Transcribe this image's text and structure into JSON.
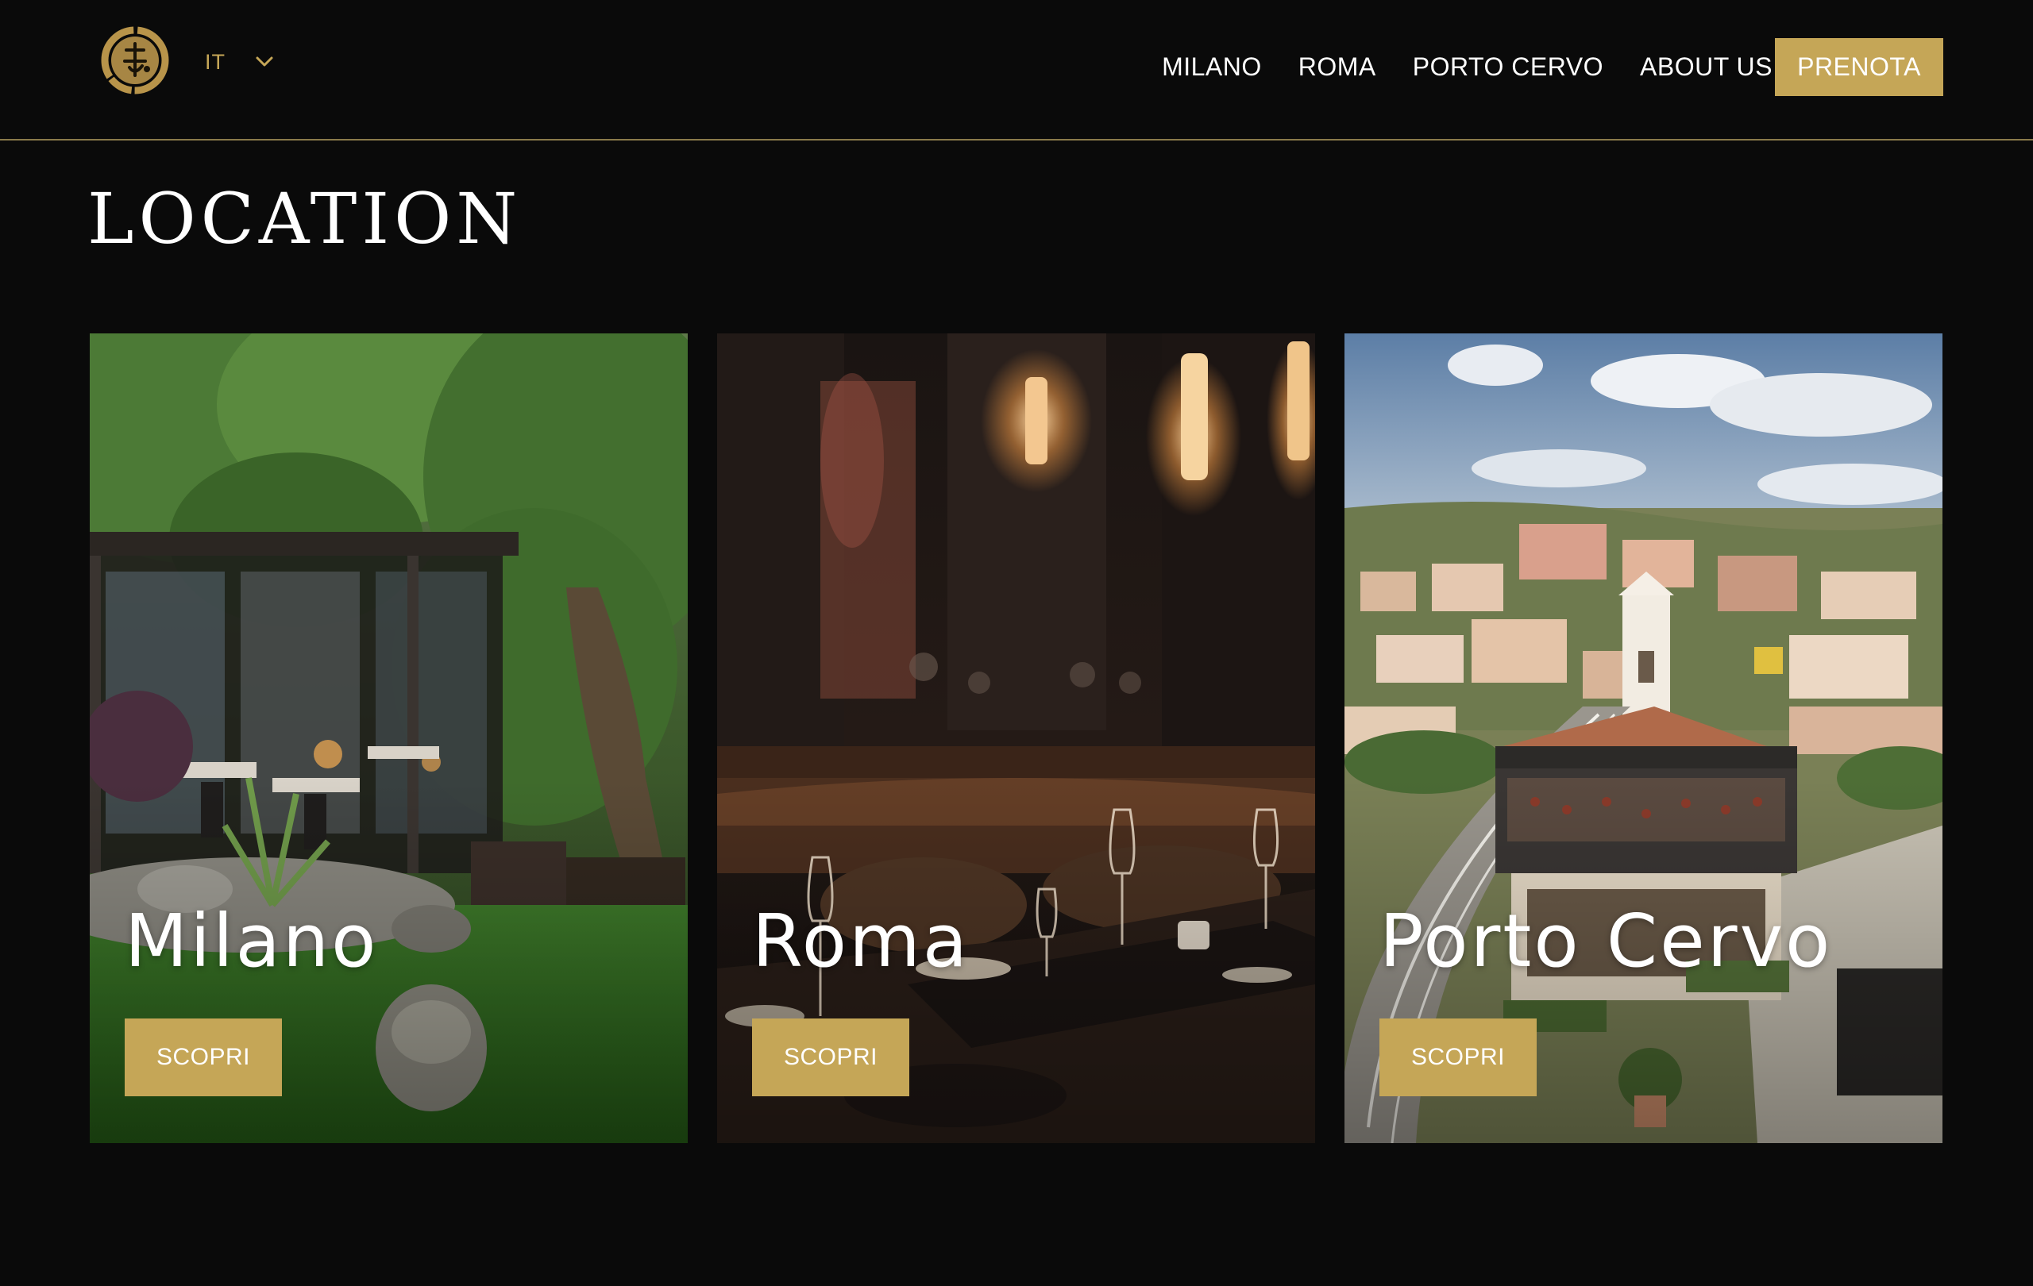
{
  "header": {
    "logo_icon": "gold-seal-logo-icon",
    "language": {
      "selected": "IT",
      "icon": "chevron-down-icon"
    },
    "nav": [
      {
        "label": "MILANO"
      },
      {
        "label": "ROMA"
      },
      {
        "label": "PORTO CERVO"
      },
      {
        "label": "ABOUT US"
      }
    ],
    "cta_label": "PRENOTA"
  },
  "main": {
    "title": "LOCATION",
    "locations": [
      {
        "name": "Milano",
        "button_label": "SCOPRI",
        "image": "garden-terrace-photo"
      },
      {
        "name": "Roma",
        "button_label": "SCOPRI",
        "image": "dim-dining-room-photo"
      },
      {
        "name": "Porto Cervo",
        "button_label": "SCOPRI",
        "image": "aerial-harbour-village-photo"
      }
    ]
  },
  "colors": {
    "background": "#0a0a0a",
    "accent_gold": "#c5a657",
    "header_rule": "#8a7a4a",
    "text": "#ffffff"
  }
}
